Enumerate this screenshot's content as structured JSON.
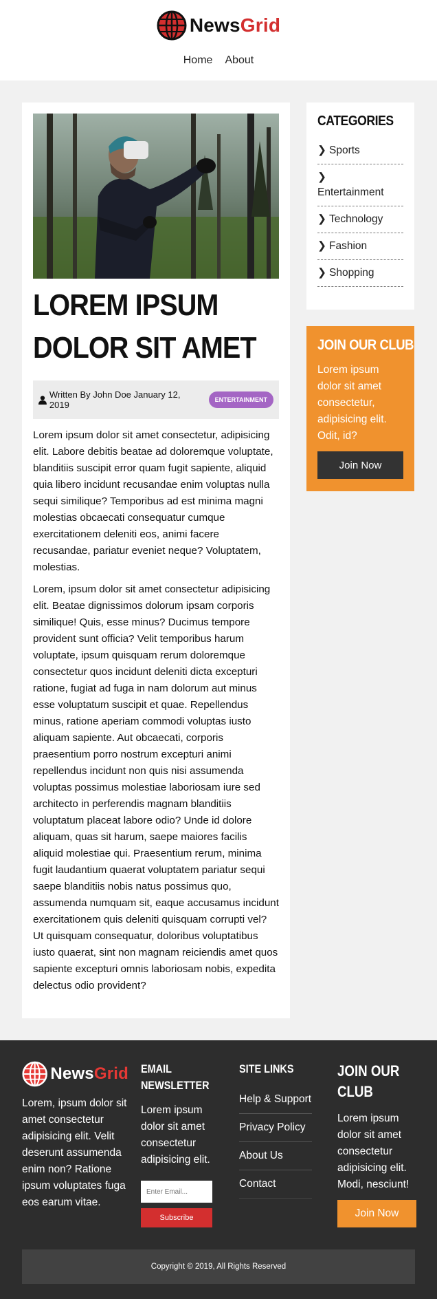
{
  "brand": {
    "name_part1": "News",
    "name_part2": "Grid"
  },
  "nav": {
    "items": [
      "Home",
      "About"
    ]
  },
  "article": {
    "title": "LOREM IPSUM DOLOR SIT AMET",
    "meta_text": "Written By John Doe January 12, 2019",
    "badge": "ENTERTAINMENT",
    "paragraphs": [
      "Lorem ipsum dolor sit amet consectetur, adipisicing elit. Labore debitis beatae ad doloremque voluptate, blanditiis suscipit error quam fugit sapiente, aliquid quia libero incidunt recusandae enim voluptas nulla sequi similique? Temporibus ad est minima magni molestias obcaecati consequatur cumque exercitationem deleniti eos, animi facere recusandae, pariatur eveniet neque? Voluptatem, molestias.",
      "Lorem, ipsum dolor sit amet consectetur adipisicing elit. Beatae dignissimos dolorum ipsam corporis similique! Quis, esse minus? Ducimus tempore provident sunt officia? Velit temporibus harum voluptate, ipsum quisquam rerum doloremque consectetur quos incidunt deleniti dicta excepturi ratione, fugiat ad fuga in nam dolorum aut minus esse voluptatum suscipit et quae. Repellendus minus, ratione aperiam commodi voluptas iusto aliquam sapiente. Aut obcaecati, corporis praesentium porro nostrum excepturi animi repellendus incidunt non quis nisi assumenda voluptas possimus molestiae laboriosam iure sed architecto in perferendis magnam blanditiis voluptatum placeat labore odio? Unde id dolore aliquam, quas sit harum, saepe maiores facilis aliquid molestiae qui. Praesentium rerum, minima fugit laudantium quaerat voluptatem pariatur sequi saepe blanditiis nobis natus possimus quo, assumenda numquam sit, eaque accusamus incidunt exercitationem quis deleniti quisquam corrupti vel? Ut quisquam consequatur, doloribus voluptatibus iusto quaerat, sint non magnam reiciendis amet quos sapiente excepturi omnis laboriosam nobis, expedita delectus odio provident?"
    ]
  },
  "sidebar": {
    "categories_heading": "Categories",
    "categories": [
      "Sports",
      "Entertainment",
      "Technology",
      "Fashion",
      "Shopping"
    ],
    "club": {
      "heading": "Join Our Club",
      "text": "Lorem ipsum dolor sit amet consectetur, adipisicing elit. Odit, id?",
      "button": "Join Now"
    }
  },
  "footer": {
    "about_text": "Lorem, ipsum dolor sit amet consectetur adipisicing elit. Velit deserunt assumenda enim non? Ratione ipsum voluptates fuga eos earum vitae.",
    "newsletter_heading": "Email Newsletter",
    "newsletter_text": "Lorem ipsum dolor sit amet consectetur adipisicing elit.",
    "email_placeholder": "Enter Email...",
    "subscribe_label": "Subscribe",
    "site_links_heading": "Site Links",
    "site_links": [
      "Help & Support",
      "Privacy Policy",
      "About Us",
      "Contact"
    ],
    "club_heading": "Join Our Club",
    "club_text": "Lorem ipsum dolor sit amet consectetur adipisicing elit. Modi, nesciunt!",
    "club_button": "Join Now",
    "copyright": "Copyright © 2019, All Rights Reserved"
  },
  "colors": {
    "accent": "#f0922e",
    "brand_red": "#d32f2f",
    "badge": "#a465c4",
    "footer_bg": "#2d2d2d"
  }
}
